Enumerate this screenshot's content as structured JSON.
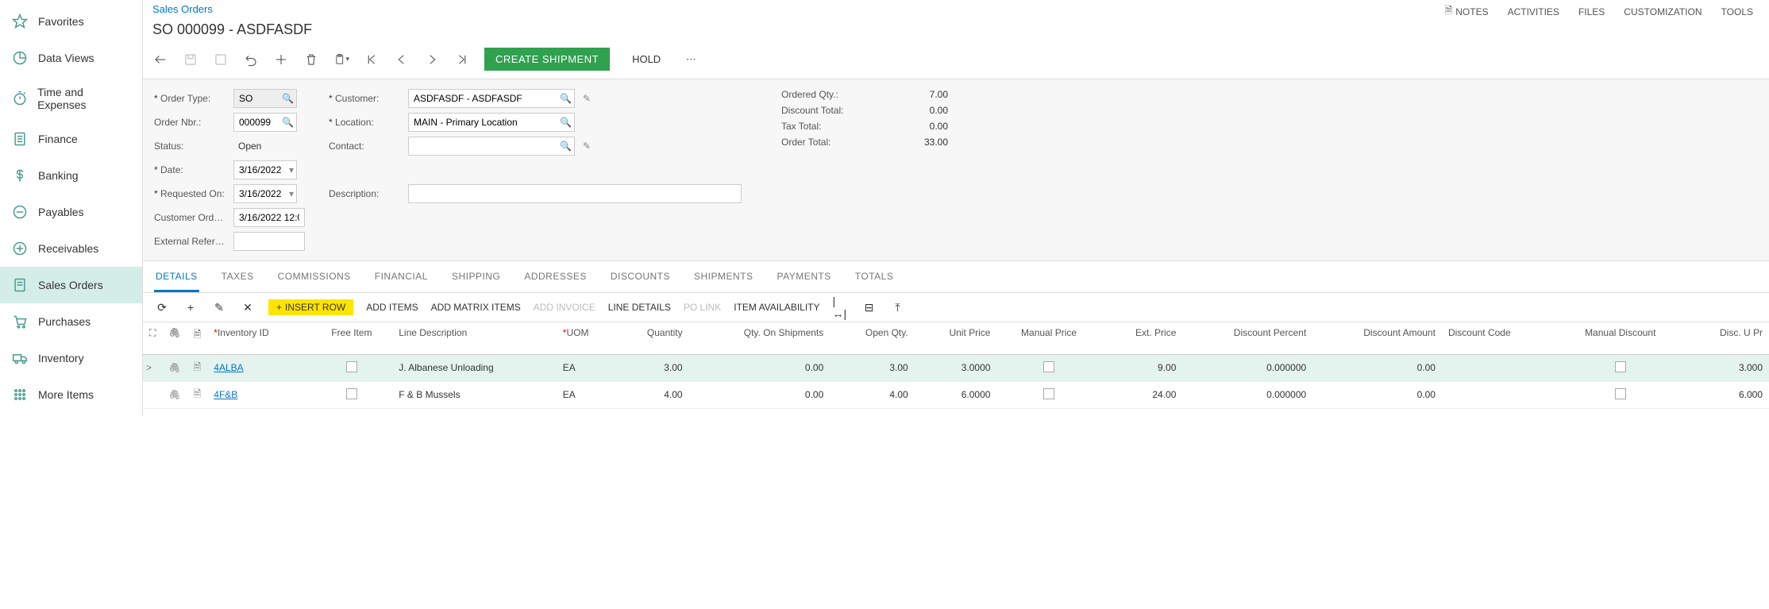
{
  "sidebar": {
    "items": [
      {
        "label": "Favorites"
      },
      {
        "label": "Data Views"
      },
      {
        "label": "Time and Expenses"
      },
      {
        "label": "Finance"
      },
      {
        "label": "Banking"
      },
      {
        "label": "Payables"
      },
      {
        "label": "Receivables"
      },
      {
        "label": "Sales Orders"
      },
      {
        "label": "Purchases"
      },
      {
        "label": "Inventory"
      },
      {
        "label": "More Items"
      }
    ]
  },
  "header": {
    "breadcrumb": "Sales Orders",
    "title": "SO 000099 - ASDFASDF",
    "top_links": {
      "notes": "NOTES",
      "activities": "ACTIVITIES",
      "files": "FILES",
      "customization": "CUSTOMIZATION",
      "tools": "TOOLS"
    },
    "toolbar": {
      "create_shipment": "CREATE SHIPMENT",
      "hold": "HOLD"
    }
  },
  "form": {
    "labels": {
      "order_type": "Order Type:",
      "order_nbr": "Order Nbr.:",
      "status": "Status:",
      "date": "Date:",
      "requested_on": "Requested On:",
      "customer_ord": "Customer Ord…",
      "external_ref": "External Refer…",
      "customer": "Customer:",
      "location": "Location:",
      "contact": "Contact:",
      "description": "Description:",
      "ordered_qty": "Ordered Qty.:",
      "discount_total": "Discount Total:",
      "tax_total": "Tax Total:",
      "order_total": "Order Total:"
    },
    "values": {
      "order_type": "SO",
      "order_nbr": "000099",
      "status": "Open",
      "date": "3/16/2022",
      "requested_on": "3/16/2022",
      "customer_ord": "3/16/2022 12:0",
      "external_ref": "",
      "customer": "ASDFASDF - ASDFASDF",
      "location": "MAIN - Primary Location",
      "contact": "",
      "description": "",
      "ordered_qty": "7.00",
      "discount_total": "0.00",
      "tax_total": "0.00",
      "order_total": "33.00"
    }
  },
  "tabs": {
    "items": [
      "DETAILS",
      "TAXES",
      "COMMISSIONS",
      "FINANCIAL",
      "SHIPPING",
      "ADDRESSES",
      "DISCOUNTS",
      "SHIPMENTS",
      "PAYMENTS",
      "TOTALS"
    ]
  },
  "grid_toolbar": {
    "insert_row": "INSERT ROW",
    "add_items": "ADD ITEMS",
    "add_matrix_items": "ADD MATRIX ITEMS",
    "add_invoice": "ADD INVOICE",
    "line_details": "LINE DETAILS",
    "po_link": "PO LINK",
    "item_availability": "ITEM AVAILABILITY"
  },
  "grid": {
    "columns": {
      "inventory_id": "Inventory ID",
      "free_item": "Free Item",
      "line_description": "Line Description",
      "uom": "UOM",
      "quantity": "Quantity",
      "qty_on_shipments": "Qty. On Shipments",
      "open_qty": "Open Qty.",
      "unit_price": "Unit Price",
      "manual_price": "Manual Price",
      "ext_price": "Ext. Price",
      "discount_percent": "Discount Percent",
      "discount_amount": "Discount Amount",
      "discount_code": "Discount Code",
      "manual_discount": "Manual Discount",
      "disc_unit_price": "Disc. U Pr"
    },
    "rows": [
      {
        "inventory_id": "4ALBA",
        "line_description": "J. Albanese Unloading",
        "uom": "EA",
        "quantity": "3.00",
        "qty_on_shipments": "0.00",
        "open_qty": "3.00",
        "unit_price": "3.0000",
        "ext_price": "9.00",
        "discount_percent": "0.000000",
        "discount_amount": "0.00",
        "disc_unit": "3.000"
      },
      {
        "inventory_id": "4F&B",
        "line_description": "F & B Mussels",
        "uom": "EA",
        "quantity": "4.00",
        "qty_on_shipments": "0.00",
        "open_qty": "4.00",
        "unit_price": "6.0000",
        "ext_price": "24.00",
        "discount_percent": "0.000000",
        "discount_amount": "0.00",
        "disc_unit": "6.000"
      }
    ]
  }
}
